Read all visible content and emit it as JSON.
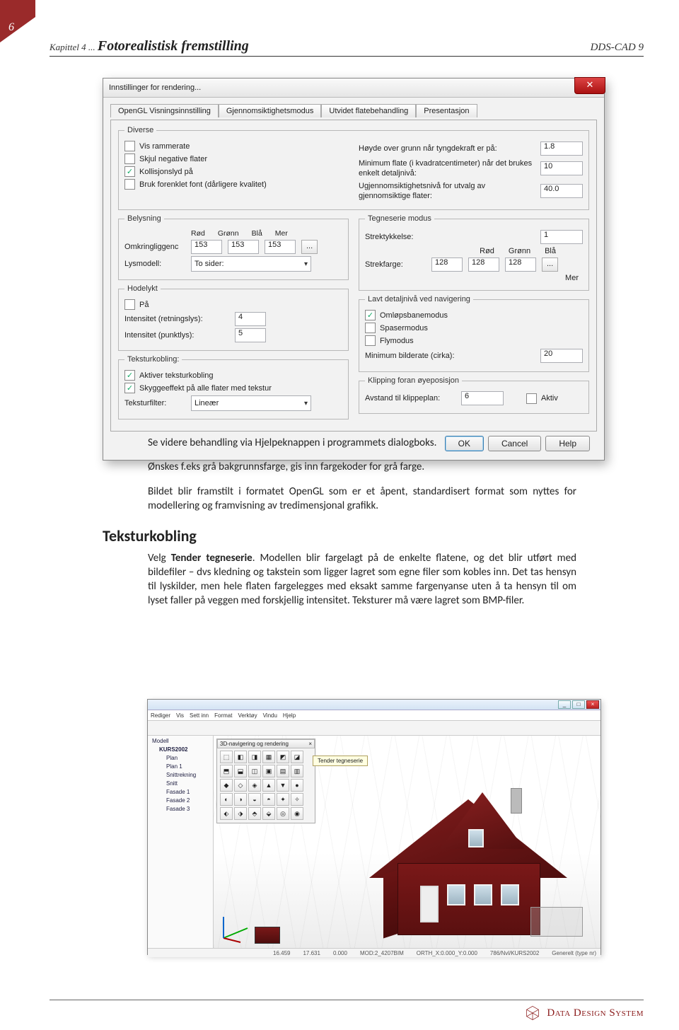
{
  "page": {
    "number": "6"
  },
  "header": {
    "left_small": "Kapittel 4 ... ",
    "left_big": "Fotorealistisk fremstilling",
    "right": "DDS-CAD 9"
  },
  "dialog": {
    "title": "Innstillinger for rendering...",
    "tabs": [
      "OpenGL Visningsinnstilling",
      "Gjennomsiktighetsmodus",
      "Utvidet flatebehandling",
      "Presentasjon"
    ],
    "diverse": {
      "legend": "Diverse",
      "vis_rammerate": {
        "label": "Vis rammerate",
        "checked": false
      },
      "skjul_negative": {
        "label": "Skjul negative flater",
        "checked": false
      },
      "kollisjon": {
        "label": "Kollisjonslyd på",
        "checked": true
      },
      "forenklet_font": {
        "label": "Bruk forenklet font (dårligere kvalitet)",
        "checked": false
      },
      "hoyde_label": "Høyde over grunn når tyngdekraft er på:",
      "hoyde_val": "1.8",
      "minflate_label": "Minimum flate (i kvadratcentimeter) når det brukes enkelt detaljnivå:",
      "minflate_val": "10",
      "ugjennom_label": "Ugjennomsiktighetsnivå for utvalg av gjennomsiktige flater:",
      "ugjennom_val": "40.0"
    },
    "belysning": {
      "legend": "Belysning",
      "heads": {
        "rod": "Rød",
        "gronn": "Grønn",
        "bla": "Blå",
        "mer": "Mer"
      },
      "omkring_label": "Omkringliggenc",
      "r": "153",
      "g": "153",
      "b": "153",
      "more": "...",
      "lysmodell_label": "Lysmodell:",
      "lysmodell_val": "To sider:"
    },
    "hodelykt": {
      "legend": "Hodelykt",
      "pa": {
        "label": "På",
        "checked": false
      },
      "retn_label": "Intensitet (retningslys):",
      "retn_val": "4",
      "punkt_label": "Intensitet (punktlys):",
      "punkt_val": "5"
    },
    "teksturkobling": {
      "legend": "Teksturkobling:",
      "aktiver": {
        "label": "Aktiver teksturkobling",
        "checked": true
      },
      "skygge": {
        "label": "Skyggeeffekt på alle flater med tekstur",
        "checked": true
      },
      "filter_label": "Teksturfilter:",
      "filter_val": "Lineær"
    },
    "tegneserie": {
      "legend": "Tegneserie modus",
      "strektykk_label": "Strektykkelse:",
      "strektykk_val": "1",
      "heads": {
        "rod": "Rød",
        "gronn": "Grønn",
        "bla": "Blå"
      },
      "strekfarge_label": "Strekfarge:",
      "r": "128",
      "g": "128",
      "b": "128",
      "more": "...",
      "mer": "Mer"
    },
    "lavt": {
      "legend": "Lavt detaljnivå ved navigering",
      "omlop": {
        "label": "Omløpsbanemodus",
        "checked": true
      },
      "spaser": {
        "label": "Spasermodus",
        "checked": false
      },
      "fly": {
        "label": "Flymodus",
        "checked": false
      },
      "minbild_label": "Minimum bilderate (cirka):",
      "minbild_val": "20"
    },
    "klipping": {
      "legend": "Klipping foran øyeposisjon",
      "avstand_label": "Avstand til klippeplan:",
      "avstand_val": "6",
      "aktiv": {
        "label": "Aktiv",
        "checked": false
      }
    },
    "buttons": {
      "ok": "OK",
      "cancel": "Cancel",
      "help": "Help"
    }
  },
  "texts": {
    "p1": "Se videre behandling via Hjelpeknappen i programmets dialogboks.",
    "p2": "Ønskes f.eks grå bakgrunnsfarge, gis inn fargekoder for grå farge.",
    "p3": "Bildet blir framstilt i formatet OpenGL som er et åpent, standardisert format som nyttes for modellering og framvisning av tredimensjonal grafikk.",
    "h2": "Teksturkobling",
    "p4a": "Velg ",
    "p4b_bold": "Tender tegneserie",
    "p4c": ". Modellen blir fargelagt på de enkelte flatene, og det blir utført med bildefiler – dvs kledning og takstein som ligger lagret som egne filer som kobles inn. Det tas hensyn til lyskilder, men hele flaten fargelegges med eksakt samme fargenyanse uten å ta hensyn til om lyset faller på veggen med forskjellig intensitet. Teksturer må være lagret som BMP-filer."
  },
  "app": {
    "menu": [
      "Rediger",
      "Vis",
      "Sett inn",
      "Format",
      "Verktøy",
      "Vindu",
      "Hjelp"
    ],
    "palette_title": "3D-navigering og rendering",
    "tooltip": "Tender tegneserie",
    "tree": {
      "root": "Modell",
      "node1": "KURS2002",
      "items": [
        "Plan",
        "Plan 1",
        "Snittrekning",
        "Snitt",
        "Fasade 1",
        "Fasade 2",
        "Fasade 3"
      ]
    },
    "status": [
      "16.459",
      "17.631",
      "0.000",
      "MOD:2_4207BIM",
      "ORTH_X:0.000_Y:0.000",
      "786/Nvl/KURS2002",
      "Generelt (type nr)"
    ]
  },
  "footer": {
    "brand": "Data Design System"
  }
}
